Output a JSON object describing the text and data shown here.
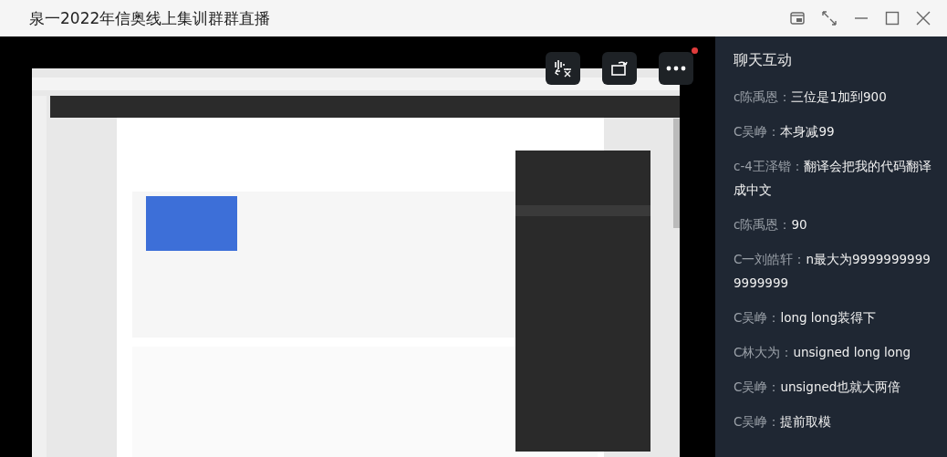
{
  "window": {
    "title": "泉一2022年信奥线上集训群群直播"
  },
  "video": {
    "kind": "picture",
    "more_badge": true
  },
  "chat": {
    "title": "聊天互动",
    "messages": [
      {
        "name": "c陈禹恩：",
        "text": "三位是1加到900"
      },
      {
        "name": "C吴峥：",
        "text": "本身减99"
      },
      {
        "name": "c-4王泽锴：",
        "text": "翻译会把我的代码翻译成中文"
      },
      {
        "name": "c陈禹恩：",
        "text": "90"
      },
      {
        "name": "C一刘皓轩：",
        "text": "n最大为99999999999999999"
      },
      {
        "name": "C吴峥：",
        "text": "long long装得下"
      },
      {
        "name": "C林大为：",
        "text": "unsigned long long"
      },
      {
        "name": "C吴峥：",
        "text": "unsigned也就大两倍"
      },
      {
        "name": "C吴峥：",
        "text": "提前取模"
      }
    ]
  }
}
